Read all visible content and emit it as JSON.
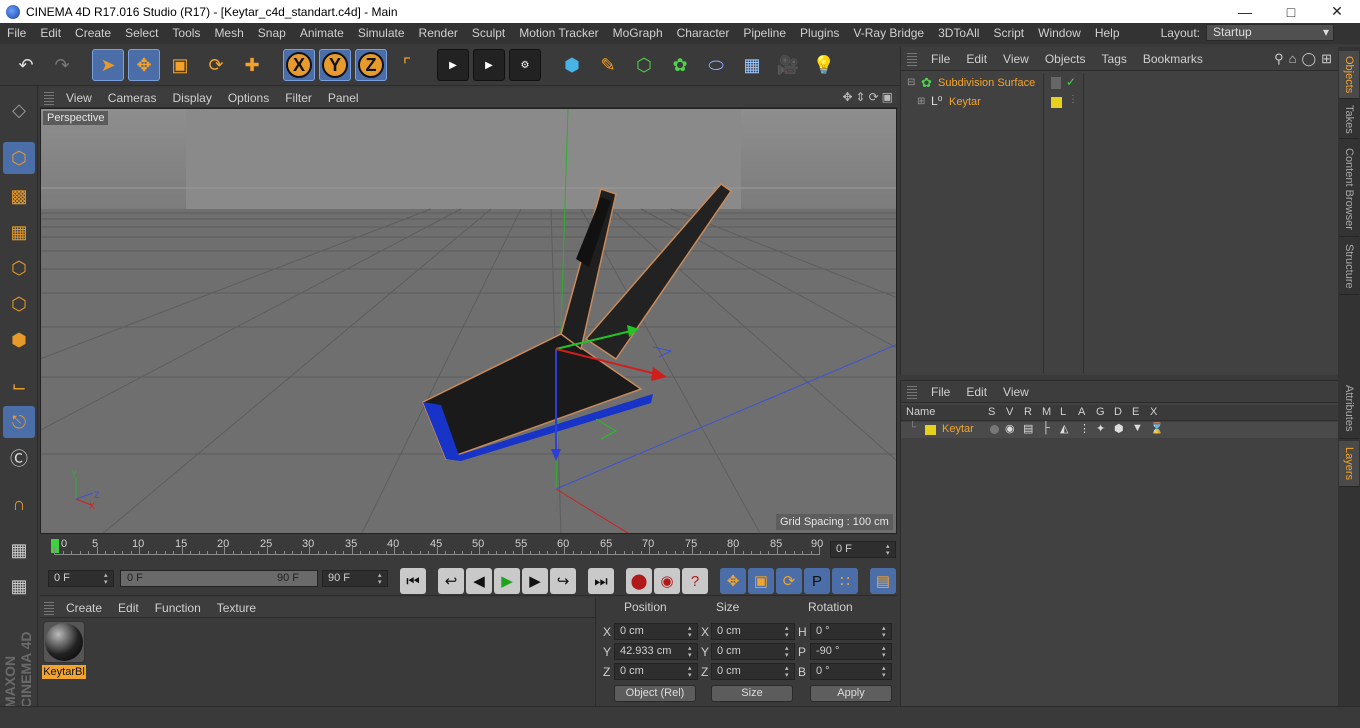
{
  "window": {
    "title": "CINEMA 4D R17.016 Studio (R17) - [Keytar_c4d_standart.c4d] - Main",
    "min_icon": "minimize-icon",
    "max_icon": "maximize-icon",
    "close_icon": "close-icon"
  },
  "menu": [
    "File",
    "Edit",
    "Create",
    "Select",
    "Tools",
    "Mesh",
    "Snap",
    "Animate",
    "Simulate",
    "Render",
    "Sculpt",
    "Motion Tracker",
    "MoGraph",
    "Character",
    "Pipeline",
    "Plugins",
    "V-Ray Bridge",
    "3DToAll",
    "Script",
    "Window",
    "Help"
  ],
  "layout": {
    "label": "Layout:",
    "value": "Startup"
  },
  "viewport": {
    "menu": [
      "View",
      "Cameras",
      "Display",
      "Options",
      "Filter",
      "Panel"
    ],
    "camera_label": "Perspective",
    "grid_spacing": "Grid Spacing : 100 cm"
  },
  "timeline": {
    "ticks": [
      "0",
      "5",
      "10",
      "15",
      "20",
      "25",
      "30",
      "35",
      "40",
      "45",
      "50",
      "55",
      "60",
      "65",
      "70",
      "75",
      "80",
      "85",
      "90"
    ],
    "current_frame": "0 F",
    "start": "0 F",
    "range_start": "0 F",
    "range_end": "90 F",
    "end": "90 F"
  },
  "material_panel": {
    "menu": [
      "Create",
      "Edit",
      "Function",
      "Texture"
    ],
    "material_name": "KeytarBl"
  },
  "coordinates": {
    "headers": {
      "position": "Position",
      "size": "Size",
      "rotation": "Rotation"
    },
    "rows": [
      {
        "axis": "X",
        "pos": "0 cm",
        "size_axis": "X",
        "size": "0 cm",
        "rot_axis": "H",
        "rot": "0 °"
      },
      {
        "axis": "Y",
        "pos": "42.933 cm",
        "size_axis": "Y",
        "size": "0 cm",
        "rot_axis": "P",
        "rot": "-90 °"
      },
      {
        "axis": "Z",
        "pos": "0 cm",
        "size_axis": "Z",
        "size": "0 cm",
        "rot_axis": "B",
        "rot": "0 °"
      }
    ],
    "mode": "Object (Rel)",
    "size_mode": "Size",
    "apply": "Apply"
  },
  "objects_panel": {
    "menu": [
      "File",
      "Edit",
      "View",
      "Objects",
      "Tags",
      "Bookmarks"
    ],
    "items": [
      {
        "name": "Subdivision Surface",
        "icon": "subdivision-icon"
      },
      {
        "name": "Keytar",
        "icon": "null-object-icon"
      }
    ]
  },
  "layers_panel": {
    "menu": [
      "File",
      "Edit",
      "View"
    ],
    "columns": [
      "Name",
      "S",
      "V",
      "R",
      "M",
      "L",
      "A",
      "G",
      "D",
      "E",
      "X"
    ],
    "layers": [
      {
        "name": "Keytar",
        "color": "#e6d21e"
      }
    ]
  },
  "side_tabs": [
    "Objects",
    "Takes",
    "Content Browser",
    "Structure",
    "Attributes",
    "Layers"
  ],
  "brand": "MAXON CINEMA 4D",
  "colors": {
    "accent": "#f3a42d",
    "selected": "#4c6ea8",
    "layer_yellow": "#e6d21e"
  }
}
